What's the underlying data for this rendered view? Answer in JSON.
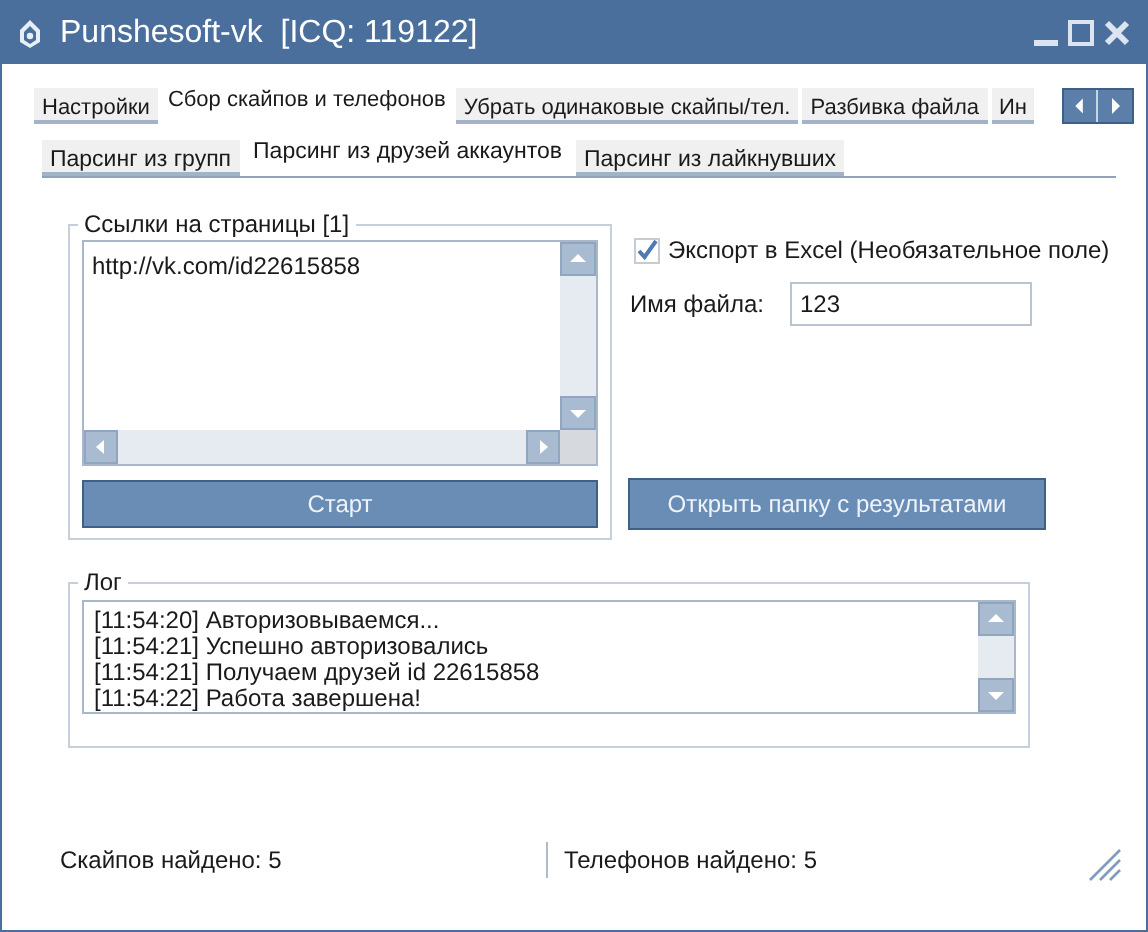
{
  "window": {
    "title": "Punshesoft-vk  [ICQ: 119122]"
  },
  "tabs": [
    {
      "label": "Настройки",
      "selected": false
    },
    {
      "label": "Сбор скайпов и телефонов",
      "selected": true
    },
    {
      "label": "Убрать одинаковые скайпы/тел.",
      "selected": false
    },
    {
      "label": "Разбивка файла",
      "selected": false
    },
    {
      "label": "Ин",
      "selected": false
    }
  ],
  "subtabs": [
    {
      "label": "Парсинг из групп",
      "selected": false
    },
    {
      "label": "Парсинг из друзей аккаунтов",
      "selected": true
    },
    {
      "label": "Парсинг из лайкнувших",
      "selected": false
    }
  ],
  "links_group": {
    "title": "Ссылки на страницы [1]",
    "text": "http://vk.com/id22615858",
    "button": "Старт"
  },
  "export": {
    "label": "Экспорт в Excel (Необязательное поле)",
    "checked": true
  },
  "file_name": {
    "label": "Имя файла:",
    "value": "123"
  },
  "open_button": "Открыть папку с результатами",
  "log": {
    "title": "Лог",
    "lines": [
      "[11:54:20] Авторизовываемся...",
      "[11:54:21] Успешно авторизовались",
      "[11:54:21] Получаем друзей id 22615858",
      "[11:54:22] Работа завершена!"
    ]
  },
  "status_bar": [
    "Скайпов найдено: 5",
    "Телефонов найдено: 5"
  ]
}
